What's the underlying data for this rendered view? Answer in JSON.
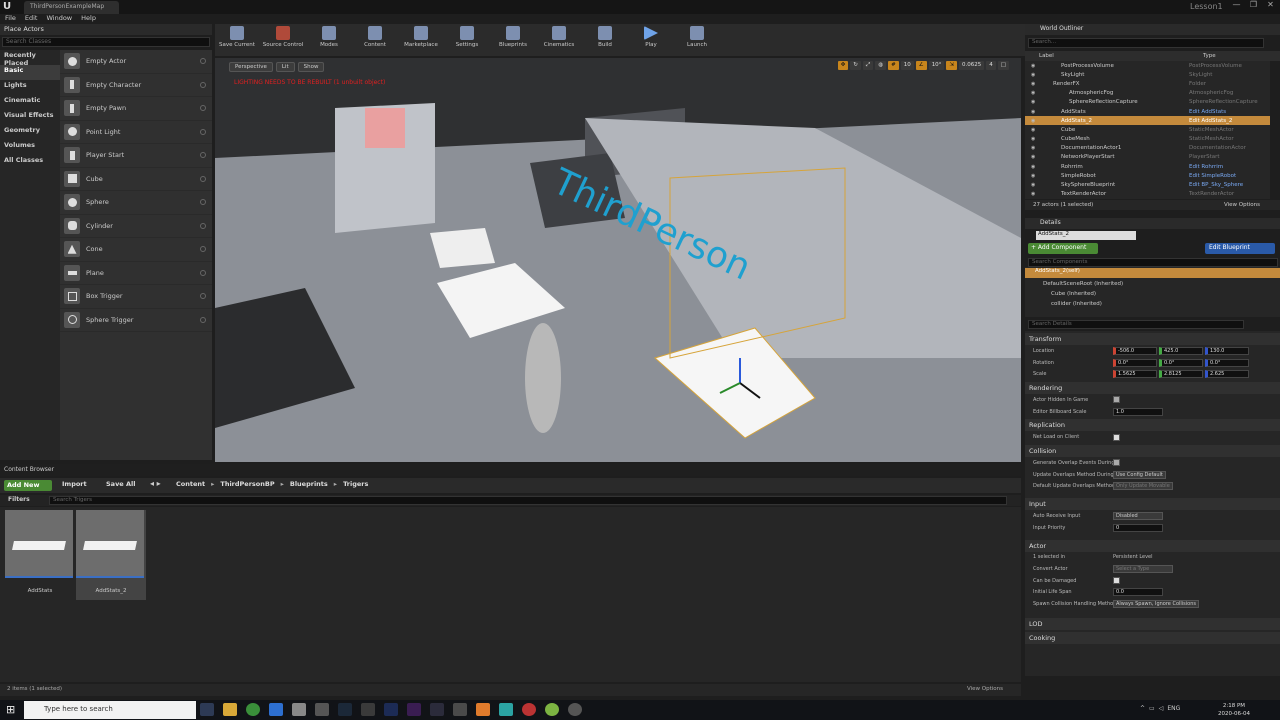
{
  "window": {
    "tab_title": "ThirdPersonExampleMap",
    "project": "Lesson1",
    "controls": [
      "—",
      "❐",
      "✕"
    ]
  },
  "menu": [
    "File",
    "Edit",
    "Window",
    "Help"
  ],
  "place_actors": {
    "tab": "Place Actors",
    "search_placeholder": "Search Classes",
    "categories": [
      "Recently Placed",
      "Basic",
      "Lights",
      "Cinematic",
      "Visual Effects",
      "Geometry",
      "Volumes",
      "All Classes"
    ],
    "items": [
      "Empty Actor",
      "Empty Character",
      "Empty Pawn",
      "Point Light",
      "Player Start",
      "Cube",
      "Sphere",
      "Cylinder",
      "Cone",
      "Plane",
      "Box Trigger",
      "Sphere Trigger"
    ]
  },
  "toolbar": [
    "Save Current",
    "Source Control",
    "Modes",
    "Content",
    "Marketplace",
    "Settings",
    "Blueprints",
    "Cinematics",
    "Build",
    "Play",
    "Launch"
  ],
  "viewport": {
    "btn_perspective": "Perspective",
    "btn_lit": "Lit",
    "btn_show": "Show",
    "warning": "LIGHTING NEEDS TO BE REBUILT (1 unbuilt object)",
    "right_controls": [
      "10",
      "10°",
      "0.0625",
      "4"
    ],
    "floor_text": "ThirdPerson"
  },
  "content_browser": {
    "tab": "Content Browser",
    "add_new": "Add New",
    "import": "Import",
    "save_all": "Save All",
    "breadcrumbs": [
      "Content",
      "ThirdPersonBP",
      "Blueprints",
      "Trigers"
    ],
    "filters": "Filters",
    "search_placeholder": "Search Trigers",
    "assets": [
      "AddStats",
      "AddStats_2"
    ],
    "status": "2 items (1 selected)",
    "view_options": "View Options"
  },
  "outliner": {
    "tab": "World Outliner",
    "search_placeholder": "Search...",
    "col_label": "Label",
    "col_type": "Type",
    "rows": [
      {
        "label": "PostProcessVolume",
        "type": "PostProcessVolume",
        "link": false
      },
      {
        "label": "SkyLight",
        "type": "SkyLight",
        "link": false
      },
      {
        "label": "RenderFX",
        "type": "Folder",
        "link": false
      },
      {
        "label": "AtmosphericFog",
        "type": "AtmosphericFog",
        "link": false
      },
      {
        "label": "SphereReflectionCapture",
        "type": "SphereReflectionCapture",
        "link": false
      },
      {
        "label": "AddStats",
        "type": "Edit AddStats",
        "link": true
      },
      {
        "label": "AddStats_2",
        "type": "Edit AddStats_2",
        "link": true,
        "selected": true
      },
      {
        "label": "Cube",
        "type": "StaticMeshActor",
        "link": false
      },
      {
        "label": "CubeMesh",
        "type": "StaticMeshActor",
        "link": false
      },
      {
        "label": "DocumentationActor1",
        "type": "DocumentationActor",
        "link": false
      },
      {
        "label": "NetworkPlayerStart",
        "type": "PlayerStart",
        "link": false
      },
      {
        "label": "Rohrrim",
        "type": "Edit Rohrrim",
        "link": true
      },
      {
        "label": "SimpleRobot",
        "type": "Edit SimpleRobot",
        "link": true
      },
      {
        "label": "SkySphereBlueprint",
        "type": "Edit BP_Sky_Sphere",
        "link": true
      },
      {
        "label": "TextRenderActor",
        "type": "TextRenderActor",
        "link": false
      }
    ],
    "status": "27 actors (1 selected)",
    "view_options": "View Options"
  },
  "details": {
    "tab": "Details",
    "name": "AddStats_2",
    "add_component": "+ Add Component",
    "edit_blueprint": "Edit Blueprint",
    "comp_search": "Search Components",
    "components": [
      "AddStats_2(self)",
      "DefaultSceneRoot (Inherited)",
      "Cube (Inherited)",
      "collider (Inherited)"
    ],
    "details_search": "Search Details",
    "transform": {
      "title": "Transform",
      "location_label": "Location",
      "location": [
        "-506.0",
        "425.0",
        "130.0"
      ],
      "rotation_label": "Rotation",
      "rotation": [
        "0.0°",
        "0.0°",
        "0.0°"
      ],
      "scale_label": "Scale",
      "scale": [
        "1.5625",
        "2.8125",
        "2.625"
      ]
    },
    "rendering": {
      "title": "Rendering",
      "hidden_label": "Actor Hidden In Game",
      "billboard_label": "Editor Billboard Scale",
      "billboard": "1.0"
    },
    "replication": {
      "title": "Replication",
      "net_load_label": "Net Load on Client"
    },
    "collision": {
      "title": "Collision",
      "gen_overlap_label": "Generate Overlap Events During L",
      "update_method_label": "Update Overlaps Method During",
      "update_method": "Use Config Default",
      "default_method_label": "Default Update Overlaps Method",
      "default_method": "Only Update Movable"
    },
    "input": {
      "title": "Input",
      "auto_receive_label": "Auto Receive Input",
      "auto_receive": "Disabled",
      "priority_label": "Input Priority",
      "priority": "0"
    },
    "actor": {
      "title": "Actor",
      "selected_in_label": "1 selected in",
      "selected_in": "Persistent Level",
      "convert_label": "Convert Actor",
      "convert": "Select a Type",
      "can_damage_label": "Can be Damaged",
      "life_span_label": "Initial Life Span",
      "life_span": "0.0",
      "spawn_label": "Spawn Collision Handling Metho",
      "spawn": "Always Spawn, Ignore Collisions"
    },
    "lod": "LOD",
    "cooking": "Cooking"
  },
  "taskbar": {
    "search": "Type here to search",
    "lang": "ENG",
    "time": "2:18 PM",
    "date": "2020-06-04"
  }
}
